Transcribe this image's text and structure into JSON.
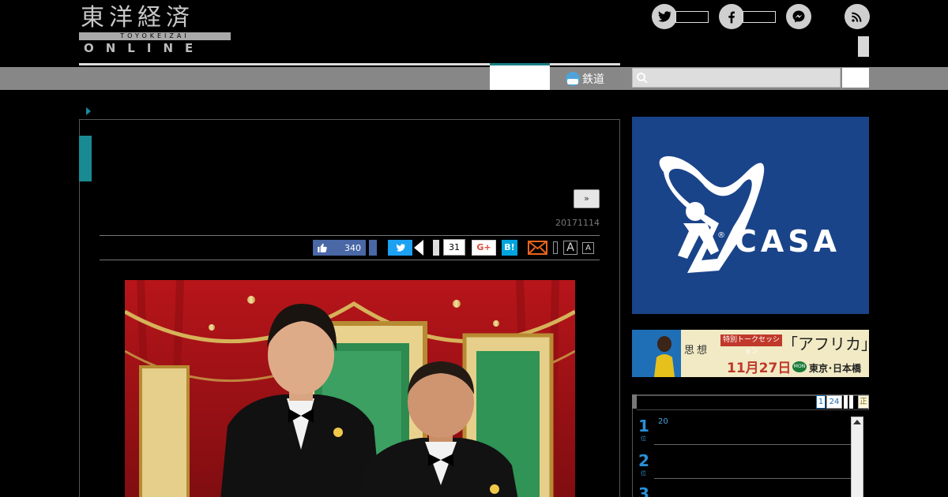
{
  "header": {
    "logo": {
      "jp": "東洋経済",
      "roman": "TOYOKEIZAI",
      "online": "ONLINE"
    },
    "social_icons": [
      "twitter-icon",
      "facebook-icon",
      "messenger-icon",
      "rss-icon"
    ]
  },
  "nav": {
    "rail_label": "鉄道",
    "search": {
      "placeholder": ""
    }
  },
  "article": {
    "next_label": "»",
    "date": "20171114",
    "share": {
      "like_count": "340",
      "comment_count": "31",
      "gplus_label": "G+",
      "hatena_label": "B!",
      "font_large": "A",
      "font_small": "A"
    }
  },
  "sidebar": {
    "ad_casa": {
      "brand": "CASA",
      "reg_mark": "®"
    },
    "ad_africa": {
      "shisou": "思想",
      "tag": "特別トークセッション",
      "title": "「アフリカ」",
      "date": "11月27日",
      "weekday": "MON",
      "place": "東京･日本橋"
    },
    "ranking": {
      "tabs": [
        "1",
        "24",
        "",
        "",
        "正"
      ],
      "items": [
        {
          "rank": "1",
          "suffix": "位",
          "text": "20"
        },
        {
          "rank": "2",
          "suffix": "位",
          "text": ""
        },
        {
          "rank": "3",
          "suffix": "位",
          "text": ""
        }
      ]
    }
  },
  "colors": {
    "teal_accent": "#1a8a92",
    "nav_gray": "#878787",
    "casa_blue": "#1a4489",
    "facebook_blue": "#4a67a6",
    "twitter_blue": "#1da1f2",
    "rank_blue": "#2a8fd8"
  }
}
